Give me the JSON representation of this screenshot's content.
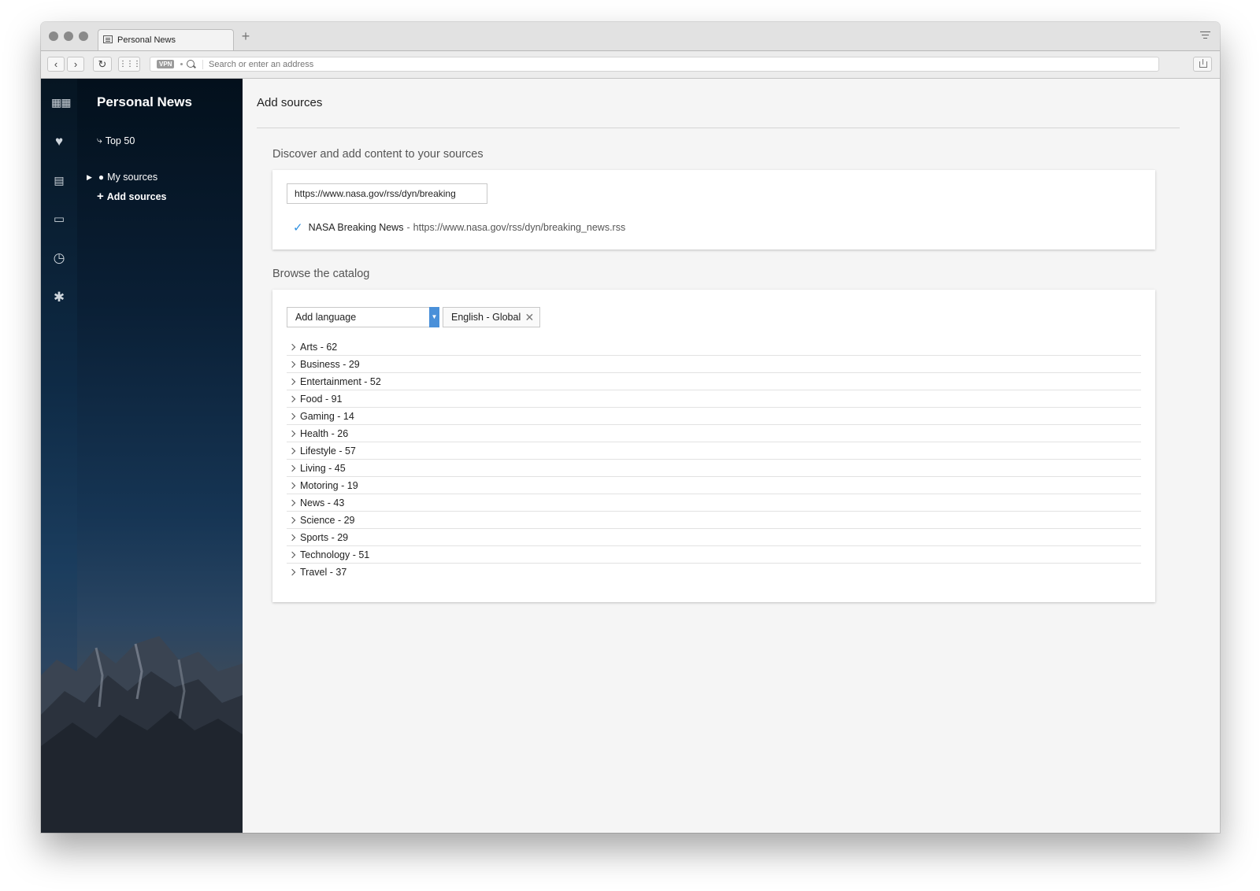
{
  "browser": {
    "tab_title": "Personal News",
    "new_tab_label": "+",
    "vpn_label": "VPN",
    "address_placeholder": "Search or enter an address"
  },
  "sidebar": {
    "title": "Personal News",
    "items": [
      {
        "label": "Top 50",
        "icon": "lightning-icon"
      },
      {
        "label": "My sources",
        "icon": "user-icon"
      },
      {
        "label": "Add sources",
        "icon": "plus-icon"
      }
    ]
  },
  "rail_icons": [
    "speed-dial-icon",
    "heart-icon",
    "news-icon",
    "devices-icon",
    "history-icon",
    "extensions-icon"
  ],
  "main": {
    "title": "Add sources",
    "discover": {
      "heading": "Discover and add content to your sources",
      "input_value": "https://www.nasa.gov/rss/dyn/breaking",
      "result_name": "NASA Breaking News",
      "result_separator": "-",
      "result_url": "https://www.nasa.gov/rss/dyn/breaking_news.rss"
    },
    "catalog": {
      "heading": "Browse the catalog",
      "language_select": "Add language",
      "selected_language": "English - Global",
      "categories": [
        "Arts - 62",
        "Business - 29",
        "Entertainment - 52",
        "Food - 91",
        "Gaming - 14",
        "Health - 26",
        "Lifestyle - 57",
        "Living - 45",
        "Motoring - 19",
        "News - 43",
        "Science - 29",
        "Sports - 29",
        "Technology - 51",
        "Travel - 37"
      ]
    }
  },
  "colors": {
    "accent": "#4a90d9",
    "check": "#2d8fe0"
  }
}
